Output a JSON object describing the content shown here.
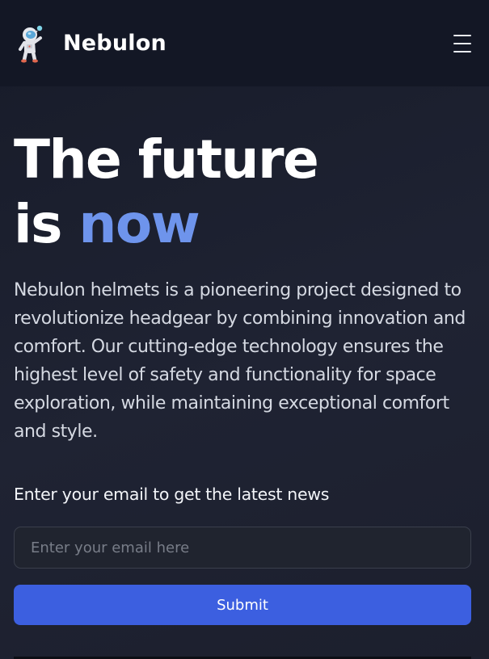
{
  "navbar": {
    "brand": "Nebulon",
    "logo_icon": "astronaut-icon",
    "menu_icon": "hamburger-menu-icon"
  },
  "hero": {
    "headline_line1": "The future",
    "headline_line2_prefix": "is ",
    "headline_line2_accent": "now",
    "description": "Nebulon helmets is a pioneering project designed to revolutionize headgear by combining innovation and comfort. Our cutting-edge technology ensures the highest level of safety and functionality for space exploration, while maintaining exceptional comfort and style."
  },
  "newsletter": {
    "label": "Enter your email to get the latest news",
    "input_value": "",
    "input_placeholder": "Enter your email here",
    "submit_label": "Submit"
  },
  "colors": {
    "accent": "#6e94ec",
    "button": "#3c5fe0",
    "navbar_bg": "#131725",
    "page_bg": "#1e2230"
  }
}
